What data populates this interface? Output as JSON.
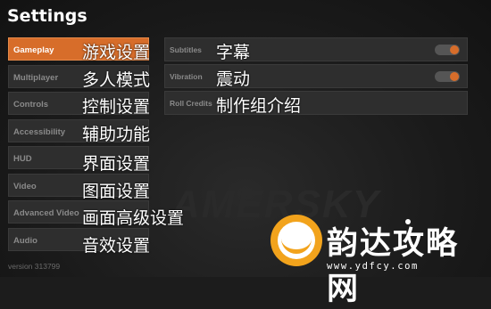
{
  "window": {
    "title": "Settings"
  },
  "menu": [
    {
      "label": "Gameplay",
      "translation": "游戏设置",
      "active": true
    },
    {
      "label": "Multiplayer",
      "translation": "多人模式",
      "active": false
    },
    {
      "label": "Controls",
      "translation": "控制设置",
      "active": false
    },
    {
      "label": "Accessibility",
      "translation": "辅助功能",
      "active": false
    },
    {
      "label": "HUD",
      "translation": "界面设置",
      "active": false
    },
    {
      "label": "Video",
      "translation": "图面设置",
      "active": false
    },
    {
      "label": "Advanced Video",
      "translation": "画面高级设置",
      "active": false
    },
    {
      "label": "Audio",
      "translation": "音效设置",
      "active": false
    }
  ],
  "panel": [
    {
      "label": "Subtitles",
      "translation": "字幕",
      "toggle": true,
      "toggle_on": true
    },
    {
      "label": "Vibration",
      "translation": "震动",
      "toggle": true,
      "toggle_on": true
    },
    {
      "label": "Roll Credits",
      "translation": "制作组介绍",
      "toggle": false
    }
  ],
  "version": "version 313799",
  "background_watermark": "AMERSKY",
  "watermark": {
    "name_cn": "韵达攻略网",
    "url": "www.ydfcy.com"
  },
  "colors": {
    "accent": "#d76d2a",
    "logo": "#f2a31c"
  }
}
